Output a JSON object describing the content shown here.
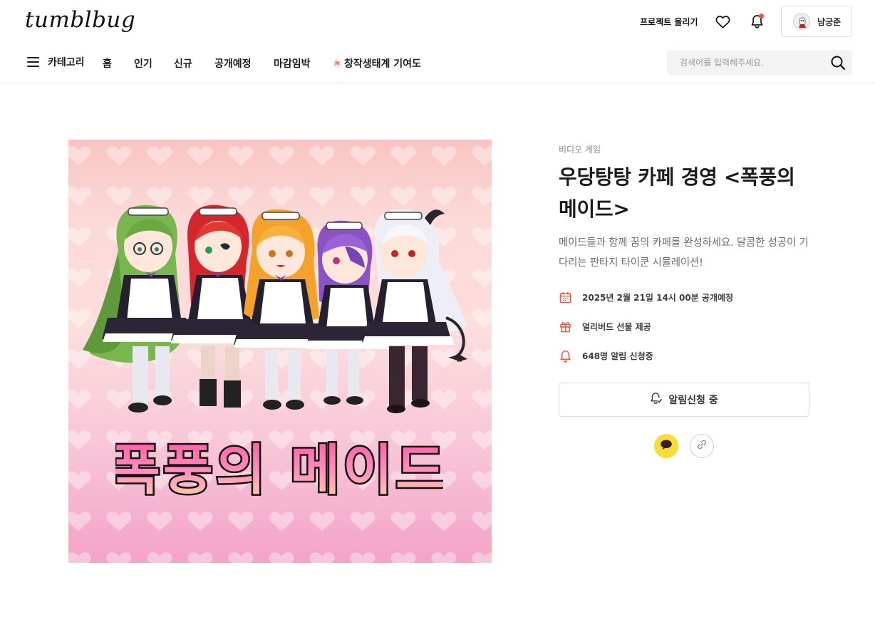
{
  "header": {
    "logo": "tumblbug",
    "upload_label": "프로젝트 올리기",
    "user_name": "남궁준",
    "icons": {
      "wishlist": "heart-icon",
      "notifications": "bell-icon"
    }
  },
  "nav": {
    "category_label": "카테고리",
    "items": [
      "홈",
      "인기",
      "신규",
      "공개예정",
      "마감임박",
      "창작생태계 기여도"
    ],
    "new_badge": "N",
    "search_placeholder": "검색어를 입력해주세요."
  },
  "project": {
    "hero_title_art": "폭풍의 메이드",
    "category": "비디오 게임",
    "title": "우당탕탕 카페 경영 <폭풍의 메이드>",
    "description": "메이드들과 함께 꿈의 카페를 완성하세요. 달콤한 성공이 기다리는 판타지 타이쿤 시뮬레이션!",
    "launch": "2025년 2월 21일 14시 00분 공개예정",
    "gift": "얼리버드 선물 제공",
    "subscribers": "648명 알림 신청중",
    "notify_button": "알림신청 중"
  },
  "colors": {
    "accent": "#f5513b",
    "kakao": "#f8dd37",
    "text": "#1c1c1c",
    "muted": "#8a8a8a"
  }
}
